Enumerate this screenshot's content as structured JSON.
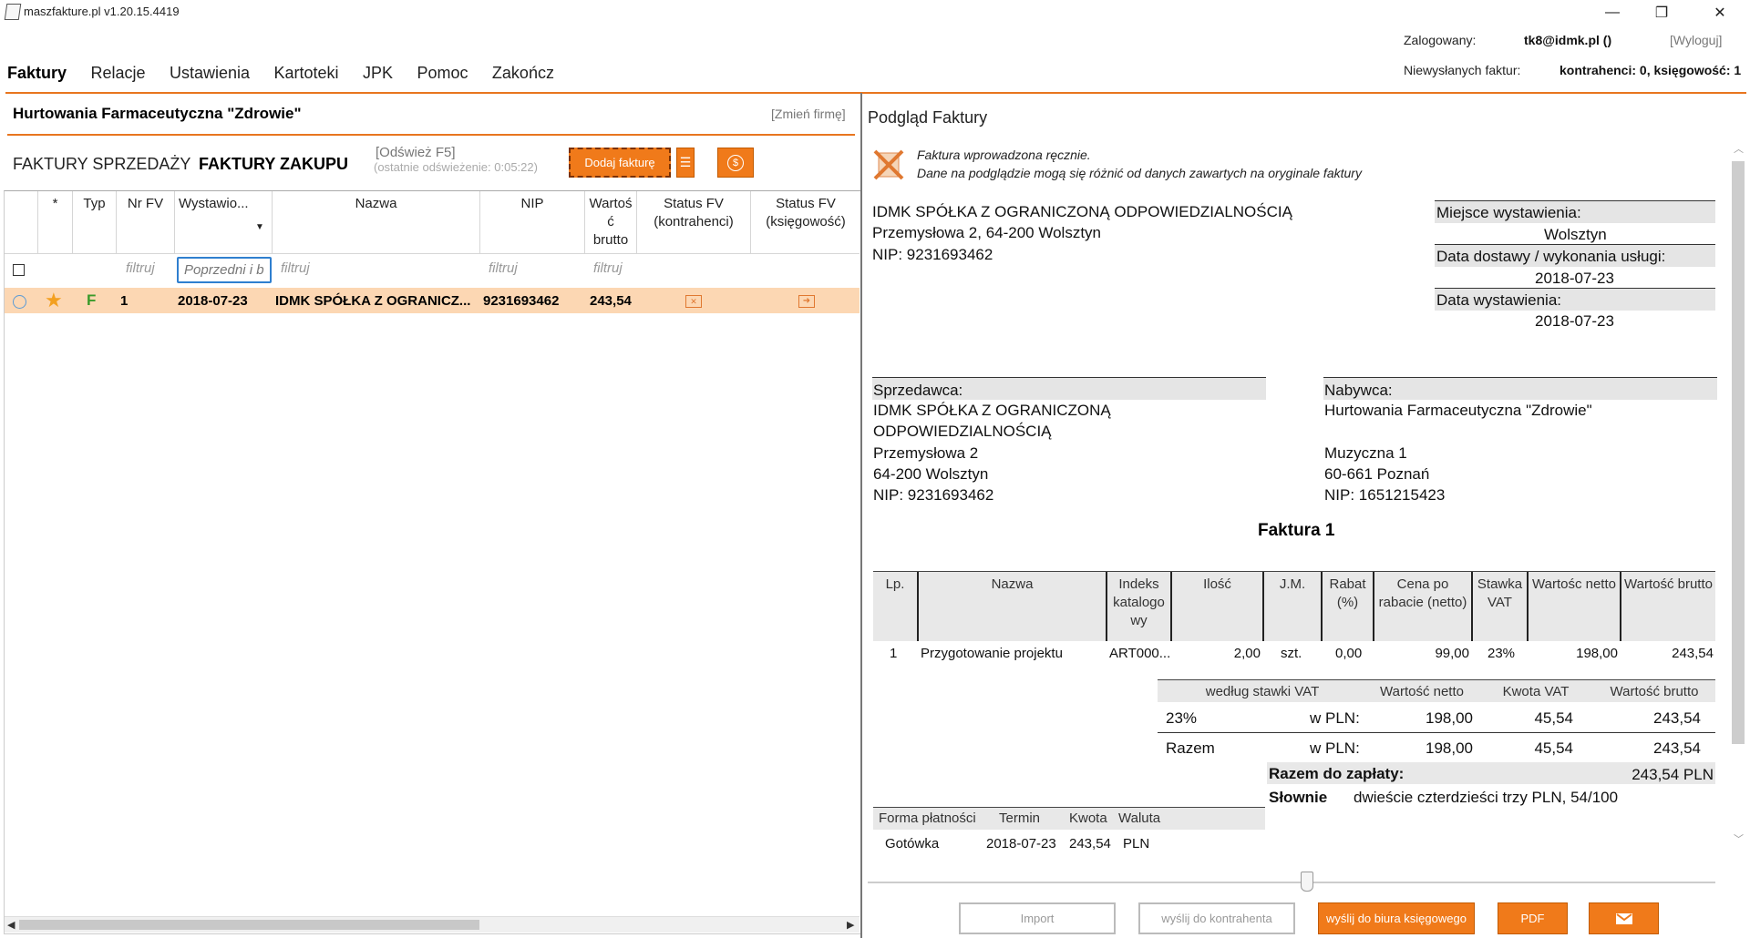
{
  "window": {
    "title": "maszfakture.pl  v1.20.15.4419",
    "min": "—",
    "max": "❐",
    "close": "✕"
  },
  "header": {
    "logged_label": "Zalogowany:",
    "logged_user": "tk8@idmk.pl ()",
    "logout": "[Wyloguj]",
    "unsent_label": "Niewysłanych faktur:",
    "unsent_value": "kontrahenci: 0, księgowość: 1"
  },
  "menu": [
    "Faktury",
    "Relacje",
    "Ustawienia",
    "Kartoteki",
    "JPK",
    "Pomoc",
    "Zakończ"
  ],
  "left": {
    "company": "Hurtowania Farmaceutyczna \"Zdrowie\"",
    "change_company": "[Zmień firmę]",
    "tab_sales": "FAKTURY SPRZEDAŻY",
    "tab_purchase": "FAKTURY ZAKUPU",
    "refresh": "[Odśwież F5]",
    "last_refresh": "(ostatnie odświeżenie: 0:05:22)",
    "add_invoice": "Dodaj fakturę",
    "columns": {
      "star": "*",
      "typ": "Typ",
      "nr": "Nr FV",
      "wyst": "Wystawio...",
      "nazwa": "Nazwa",
      "nip": "NIP",
      "wartosc": "Wartoś ć brutto",
      "status_k": "Status FV (kontrahenci)",
      "status_ks": "Status FV (księgowość)"
    },
    "filter_placeholder": "filtruj",
    "date_filter_value": "Poprzedni i b",
    "row": {
      "typ": "F",
      "nr": "1",
      "date": "2018-07-23",
      "nazwa": "IDMK SPÓŁKA Z OGRANICZ...",
      "nip": "9231693462",
      "wartosc": "243,54"
    }
  },
  "preview": {
    "title": "Podgląd Faktury",
    "notice_line1": "Faktura wprowadzona ręcznie.",
    "notice_line2": "Dane na podglądzie mogą się różnić od danych zawartych na oryginale faktury",
    "issuer_name": "IDMK SPÓŁKA Z OGRANICZONĄ ODPOWIEDZIALNOŚCIĄ",
    "issuer_address": "Przemysłowa 2, 64-200 Wolsztyn",
    "issuer_nip": "NIP: 9231693462",
    "place_label": "Miejsce wystawienia:",
    "place_value": "Wolsztyn",
    "delivery_label": "Data dostawy / wykonania usługi:",
    "delivery_value": "2018-07-23",
    "issue_label": "Data wystawienia:",
    "issue_value": "2018-07-23",
    "seller_label": "Sprzedawca:",
    "seller_line1": "IDMK SPÓŁKA Z OGRANICZONĄ",
    "seller_line2": "ODPOWIEDZIALNOŚCIĄ",
    "seller_line3": "Przemysłowa 2",
    "seller_line4": "64-200 Wolsztyn",
    "seller_line5": "NIP: 9231693462",
    "buyer_label": "Nabywca:",
    "buyer_line1": "Hurtowania Farmaceutyczna \"Zdrowie\"",
    "buyer_line3": "Muzyczna 1",
    "buyer_line4": "60-661 Poznań",
    "buyer_line5": "NIP: 1651215423",
    "invoice_title": "Faktura 1",
    "items_headers": {
      "lp": "Lp.",
      "nazwa": "Nazwa",
      "indeks": "Indeks katalogo wy",
      "ilosc": "Ilość",
      "jm": "J.M.",
      "rabat": "Rabat (%)",
      "cena": "Cena po rabacie (netto)",
      "stawka": "Stawka VAT",
      "netto": "Wartośc netto",
      "brutto": "Wartość brutto"
    },
    "item": {
      "lp": "1",
      "nazwa": "Przygotowanie projektu",
      "indeks": "ART000...",
      "ilosc": "2,00",
      "jm": "szt.",
      "rabat": "0,00",
      "cena": "99,00",
      "stawka": "23%",
      "netto": "198,00",
      "brutto": "243,54"
    },
    "vat_headers": {
      "rate": "według stawki VAT",
      "netto": "Wartość netto",
      "kwota": "Kwota VAT",
      "brutto": "Wartość brutto"
    },
    "vat_row": {
      "rate": "23%",
      "cur": "w PLN:",
      "netto": "198,00",
      "kwota": "45,54",
      "brutto": "243,54"
    },
    "sum_row": {
      "label": "Razem",
      "cur": "w PLN:",
      "netto": "198,00",
      "kwota": "45,54",
      "brutto": "243,54"
    },
    "to_pay_label": "Razem do zapłaty:",
    "to_pay_value": "243,54 PLN",
    "words_label": "Słownie",
    "words_value": "dwieście czterdzieści trzy PLN, 54/100",
    "payment_headers": {
      "form": "Forma płatności",
      "term": "Termin",
      "amount": "Kwota",
      "currency": "Waluta"
    },
    "payment_row": {
      "form": "Gotówka",
      "term": "2018-07-23",
      "amount": "243,54",
      "currency": "PLN"
    }
  },
  "buttons": {
    "import": "Import",
    "send_contractor": "wyślij do kontrahenta",
    "send_office": "wyślij do biura księgowego",
    "pdf": "PDF"
  }
}
